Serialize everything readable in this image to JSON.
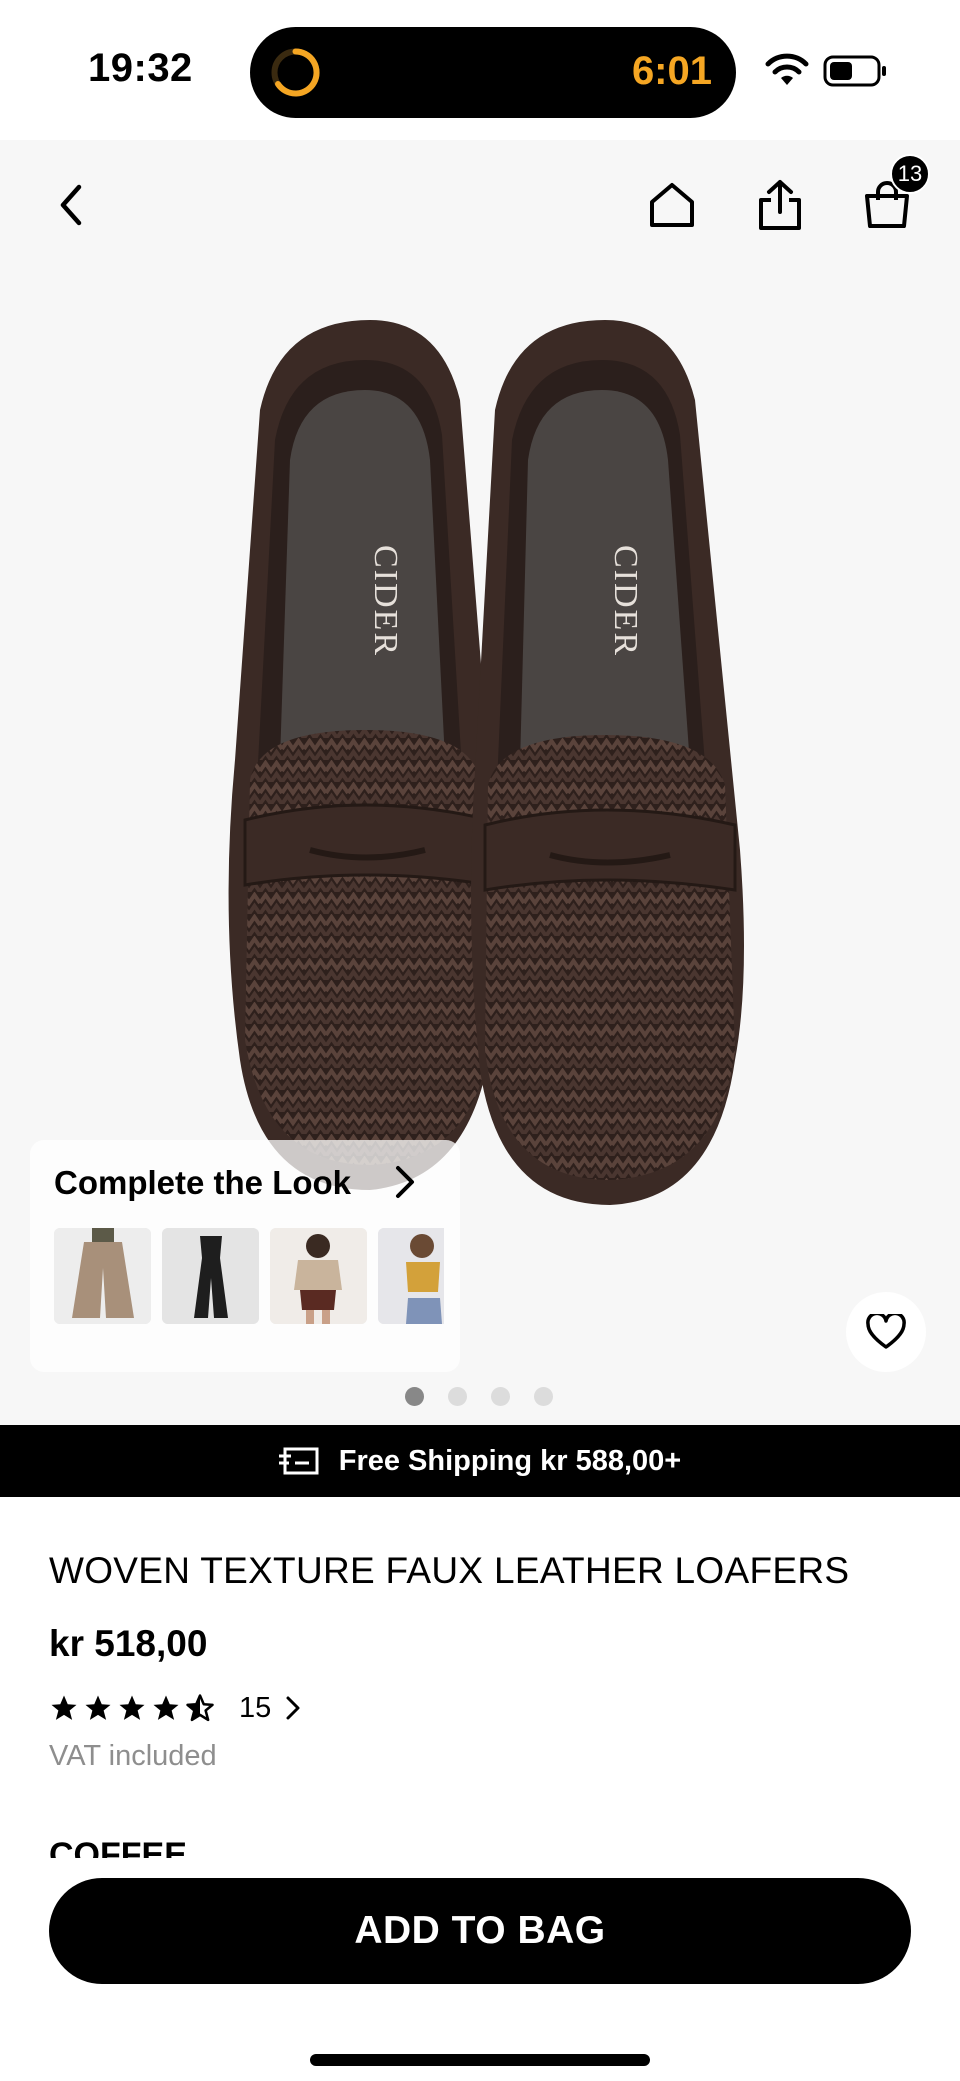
{
  "status_bar": {
    "time": "19:32",
    "timer": "6:01",
    "icons": [
      "timer-ring-icon",
      "wifi-icon",
      "battery-icon"
    ]
  },
  "nav": {
    "cart_count": "13",
    "icons": [
      "back-chevron-icon",
      "home-icon",
      "share-icon",
      "shopping-bag-icon"
    ]
  },
  "product_image": {
    "brand_mark": "CIDER",
    "carousel_pages": 4,
    "carousel_active": 1
  },
  "complete_look": {
    "title": "Complete the Look",
    "items": [
      "wide-leg trousers",
      "black jumpsuit",
      "printed blouse outfit",
      "mustard top outfit"
    ]
  },
  "shipping": {
    "text": "Free Shipping kr 588,00+"
  },
  "product": {
    "name": "WOVEN TEXTURE FAUX LEATHER LOAFERS",
    "price": "kr 518,00",
    "rating": 4.5,
    "review_count": "15",
    "vat_note": "VAT included",
    "color_label": "COFFEE"
  },
  "cta": {
    "add_to_bag": "ADD TO BAG"
  },
  "colors": {
    "accent": "#000000",
    "timer": "#f5a623",
    "shoe": "#3b2a25",
    "background": "#f7f7f7"
  }
}
